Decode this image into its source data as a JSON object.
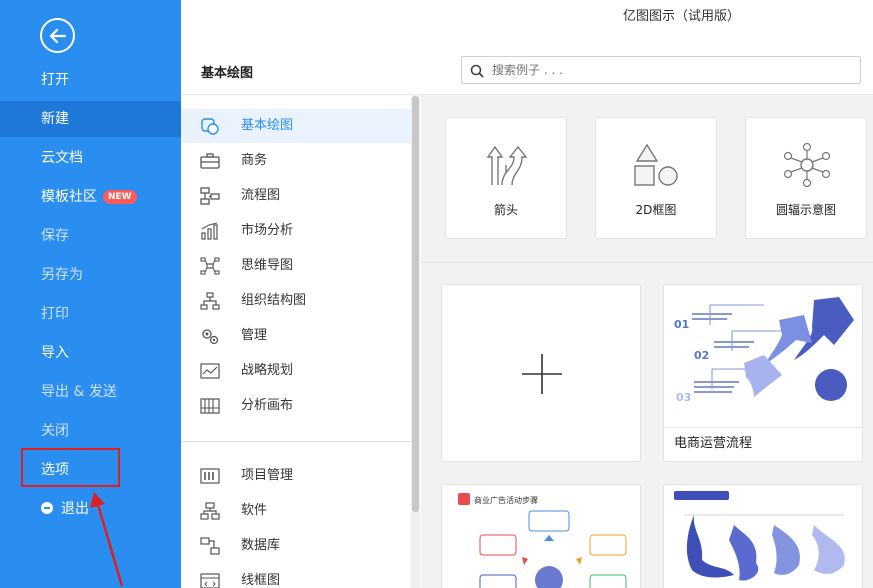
{
  "window": {
    "title": "亿图图示（试用版）"
  },
  "sidebar": {
    "items": [
      {
        "label": "打开"
      },
      {
        "label": "新建"
      },
      {
        "label": "云文档"
      },
      {
        "label": "模板社区",
        "badge": "NEW"
      },
      {
        "label": "保存"
      },
      {
        "label": "另存为"
      },
      {
        "label": "打印"
      },
      {
        "label": "导入"
      },
      {
        "label": "导出 & 发送"
      },
      {
        "label": "关闭"
      },
      {
        "label": "选项"
      },
      {
        "label": "退出"
      }
    ]
  },
  "header": {
    "section_title": "基本绘图"
  },
  "search": {
    "placeholder": "搜索例子 . . ."
  },
  "categories": [
    {
      "label": "基本绘图"
    },
    {
      "label": "商务"
    },
    {
      "label": "流程图"
    },
    {
      "label": "市场分析"
    },
    {
      "label": "思维导图"
    },
    {
      "label": "组织结构图"
    },
    {
      "label": "管理"
    },
    {
      "label": "战略规划"
    },
    {
      "label": "分析画布"
    },
    {
      "label": "项目管理"
    },
    {
      "label": "软件"
    },
    {
      "label": "数据库"
    },
    {
      "label": "线框图"
    }
  ],
  "tiles": [
    {
      "label": "箭头"
    },
    {
      "label": "2D框图"
    },
    {
      "label": "圆辐示意图"
    }
  ],
  "templates": [
    {
      "label": ""
    },
    {
      "label": "电商运营流程"
    },
    {
      "label": ""
    },
    {
      "label": ""
    }
  ],
  "thumbnails": {
    "ecommerce": {
      "n1": "01",
      "n2": "02",
      "n3": "03"
    },
    "ad_steps": {
      "title": "商业广告活动步骤"
    }
  },
  "colors": {
    "sidebar": "#2a8ef0",
    "sidebar_active": "#1e78d8",
    "accent": "#2a8ef0",
    "highlight": "#e02020",
    "badge": "#ff5b5b"
  }
}
